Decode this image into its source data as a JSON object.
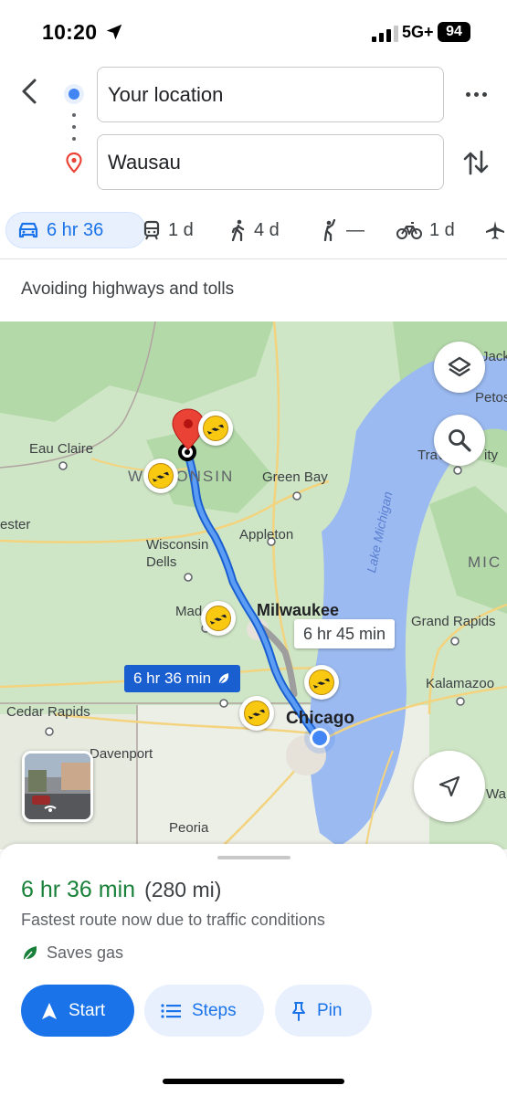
{
  "status_bar": {
    "time": "10:20",
    "network": "5G+",
    "battery": "94"
  },
  "search": {
    "origin": "Your location",
    "destination": "Wausau"
  },
  "modes": [
    {
      "id": "drive",
      "label": "6 hr 36",
      "active": true
    },
    {
      "id": "transit",
      "label": "1 d"
    },
    {
      "id": "walk",
      "label": "4 d"
    },
    {
      "id": "ride",
      "label": "—"
    },
    {
      "id": "bike",
      "label": "1 d"
    },
    {
      "id": "flight",
      "label": ""
    }
  ],
  "route_options_note": "Avoiding highways and tolls",
  "map": {
    "labels": {
      "eau_claire": "Eau Claire",
      "wisconsin": "WISCONSIN",
      "green_bay": "Green Bay",
      "appleton": "Appleton",
      "wisconsin_dells": "Wisconsin Dells",
      "madison": "Mad",
      "milwaukee": "Milwaukee",
      "lake_michigan": "Lake Michigan",
      "grand_rapids": "Grand Rapids",
      "kalamazoo": "Kalamazoo",
      "chicago": "Chicago",
      "cedar_rapids": "Cedar Rapids",
      "davenport": "Davenport",
      "peoria": "Peoria",
      "mic": "MIC",
      "petos": "Petos",
      "jack": "Jack",
      "trav_city": "Trav",
      "city": "ity",
      "ester": "ester",
      "wa": "Wa"
    },
    "callouts": {
      "primary_route": "6 hr 36 min",
      "alternate_route": "6 hr 45 min"
    }
  },
  "route_summary": {
    "duration": "6 hr 36 min",
    "distance": "(280 mi)",
    "reason": "Fastest route now due to traffic conditions",
    "eco_label": "Saves gas"
  },
  "actions": {
    "start": "Start",
    "steps": "Steps",
    "pin": "Pin"
  },
  "colors": {
    "accent": "#1a73e8",
    "duration_green": "#188038",
    "route_blue": "#4a86e8",
    "water": "#9bbaf1"
  }
}
